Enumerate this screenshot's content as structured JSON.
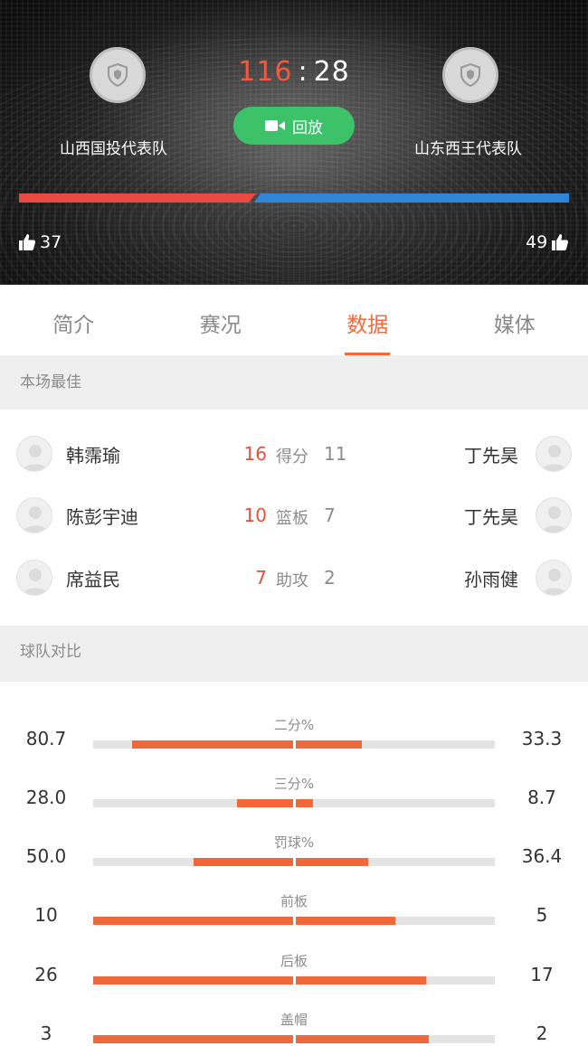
{
  "header": {
    "home_team": "山西国投代表队",
    "away_team": "山东西王代表队",
    "home_score": "116",
    "away_score": "28",
    "score_sep": ":",
    "replay_label": "回放",
    "home_likes": "37",
    "away_likes": "49",
    "home_color": "#e84a42",
    "away_color": "#2f86d9",
    "replay_color": "#3cc36a"
  },
  "tabs": [
    {
      "label": "简介"
    },
    {
      "label": "赛况"
    },
    {
      "label": "数据",
      "active": true
    },
    {
      "label": "媒体"
    }
  ],
  "best": {
    "title": "本场最佳",
    "rows": [
      {
        "home_player": "韩霈瑜",
        "home_value": "16",
        "label": "得分",
        "away_value": "11",
        "away_player": "丁先昊"
      },
      {
        "home_player": "陈彭宇迪",
        "home_value": "10",
        "label": "篮板",
        "away_value": "7",
        "away_player": "丁先昊"
      },
      {
        "home_player": "席益民",
        "home_value": "7",
        "label": "助攻",
        "away_value": "2",
        "away_player": "孙雨健"
      }
    ]
  },
  "compare": {
    "title": "球队对比",
    "bar_color": "#f0673a",
    "rows": [
      {
        "label": "二分%",
        "home": "80.7",
        "away": "33.3",
        "home_fill": 0.807,
        "away_fill": 0.333
      },
      {
        "label": "三分%",
        "home": "28.0",
        "away": "8.7",
        "home_fill": 0.28,
        "away_fill": 0.087
      },
      {
        "label": "罚球%",
        "home": "50.0",
        "away": "36.4",
        "home_fill": 0.5,
        "away_fill": 0.364
      },
      {
        "label": "前板",
        "home": "10",
        "away": "5",
        "home_fill": 1.0,
        "away_fill": 0.5
      },
      {
        "label": "后板",
        "home": "26",
        "away": "17",
        "home_fill": 1.0,
        "away_fill": 0.654
      },
      {
        "label": "盖帽",
        "home": "3",
        "away": "2",
        "home_fill": 1.0,
        "away_fill": 0.667
      }
    ]
  }
}
